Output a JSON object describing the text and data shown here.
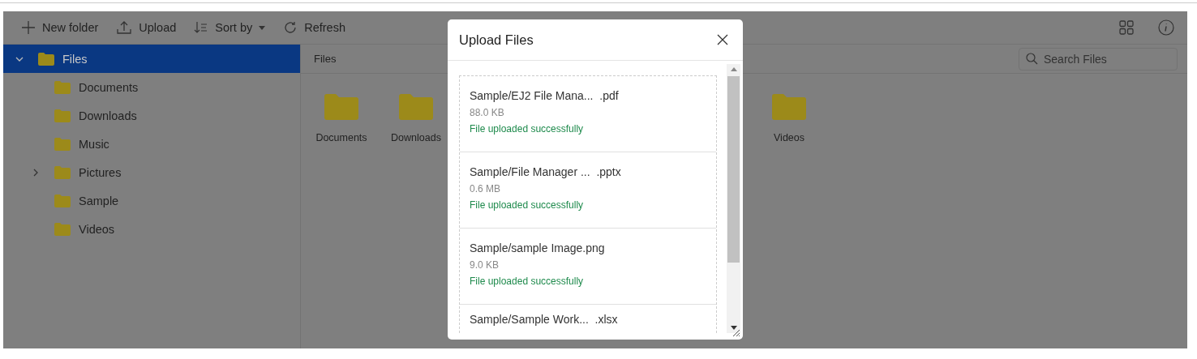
{
  "toolbar": {
    "items": [
      {
        "kind": "new",
        "label": "New folder"
      },
      {
        "kind": "upload",
        "label": "Upload"
      },
      {
        "kind": "sort",
        "label": "Sort by"
      },
      {
        "kind": "refresh",
        "label": "Refresh"
      }
    ]
  },
  "tree": {
    "label": "Files",
    "expanded": true,
    "selected": true,
    "children": [
      {
        "label": "Documents",
        "selected": false
      },
      {
        "label": "Downloads",
        "selected": false
      },
      {
        "label": "Music",
        "selected": false
      },
      {
        "label": "Pictures",
        "selected": false,
        "expanded": false
      },
      {
        "label": "Sample",
        "selected": false
      },
      {
        "label": "Videos",
        "selected": false
      }
    ]
  },
  "address_bar": {
    "path": "Files"
  },
  "search": {
    "placeholder": "Search Files"
  },
  "folders": [
    {
      "label": "Documents"
    },
    {
      "label": "Downloads"
    },
    {
      "label": "Videos"
    }
  ],
  "dialog": {
    "title": "Upload Files",
    "files": [
      {
        "name": "Sample/EJ2 File Mana...  .pdf",
        "size": "88.0 KB",
        "status": "File uploaded successfully"
      },
      {
        "name": "Sample/File Manager ...  .pptx",
        "size": "0.6 MB",
        "status": "File uploaded successfully"
      },
      {
        "name": "Sample/sample Image.png",
        "size": "9.0 KB",
        "status": "File uploaded successfully"
      },
      {
        "name": "Sample/Sample Work...  .xlsx"
      }
    ]
  }
}
